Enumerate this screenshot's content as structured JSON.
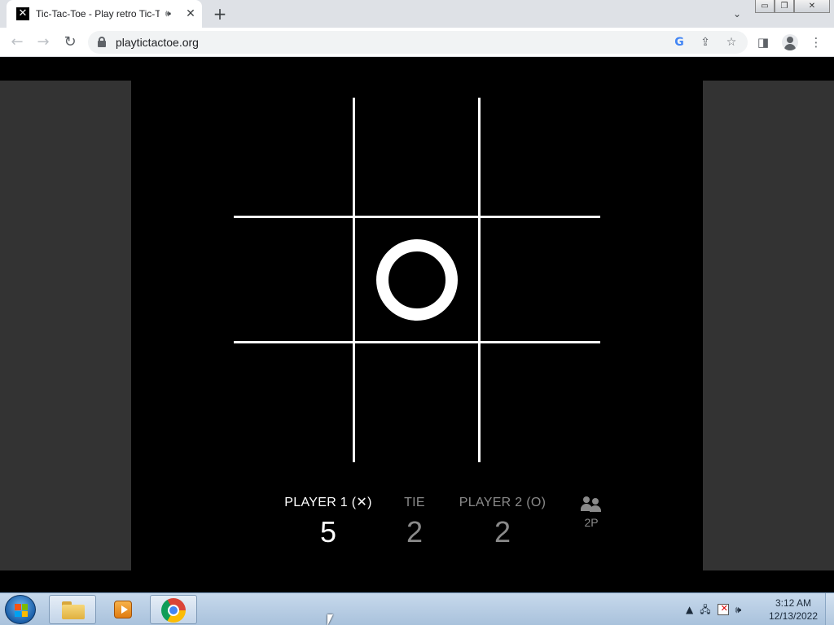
{
  "browser": {
    "tab": {
      "favicon_glyph": "✕",
      "title": "Tic-Tac-Toe - Play retro Tic-Tac-Toe online for free",
      "audio_glyph": "🕪",
      "close_glyph": "✕"
    },
    "new_tab_glyph": "+",
    "tab_search_glyph": "⌄",
    "window_controls": {
      "minimize": "▭",
      "restore": "❐",
      "close": "✕"
    },
    "toolbar": {
      "back_glyph": "←",
      "forward_glyph": "→",
      "reload_glyph": "↻",
      "url": "playtictactoe.org",
      "google_glyph": "G",
      "share_glyph": "⇪",
      "bookmark_glyph": "☆",
      "side_panel_glyph": "◨",
      "menu_glyph": "⋮"
    }
  },
  "game": {
    "board": [
      [
        "",
        "",
        ""
      ],
      [
        "",
        "O",
        ""
      ],
      [
        "",
        "",
        ""
      ]
    ],
    "scores": {
      "player1": {
        "label": "PLAYER 1 (✕)",
        "value": "5"
      },
      "tie": {
        "label": "TIE",
        "value": "2"
      },
      "player2": {
        "label": "PLAYER 2 (O)",
        "value": "2"
      }
    },
    "mode": {
      "label": "2P",
      "icon": "two-players-icon"
    }
  },
  "taskbar": {
    "apps": [
      {
        "name": "windows-explorer",
        "icon": "folder-icon",
        "active": true
      },
      {
        "name": "windows-media-player",
        "icon": "media-player-icon",
        "active": false
      },
      {
        "name": "google-chrome",
        "icon": "chrome-icon",
        "active": true
      }
    ],
    "tray": {
      "show_hidden_glyph": "▲",
      "network_glyph": "🖧",
      "volume_glyph": "🕪"
    },
    "clock": {
      "time": "3:12 AM",
      "date": "12/13/2022"
    }
  },
  "colors": {
    "board_lines": "#ffffff",
    "active_score": "#ffffff",
    "inactive_score": "#8a8a8a",
    "side_panels": "#333333"
  }
}
